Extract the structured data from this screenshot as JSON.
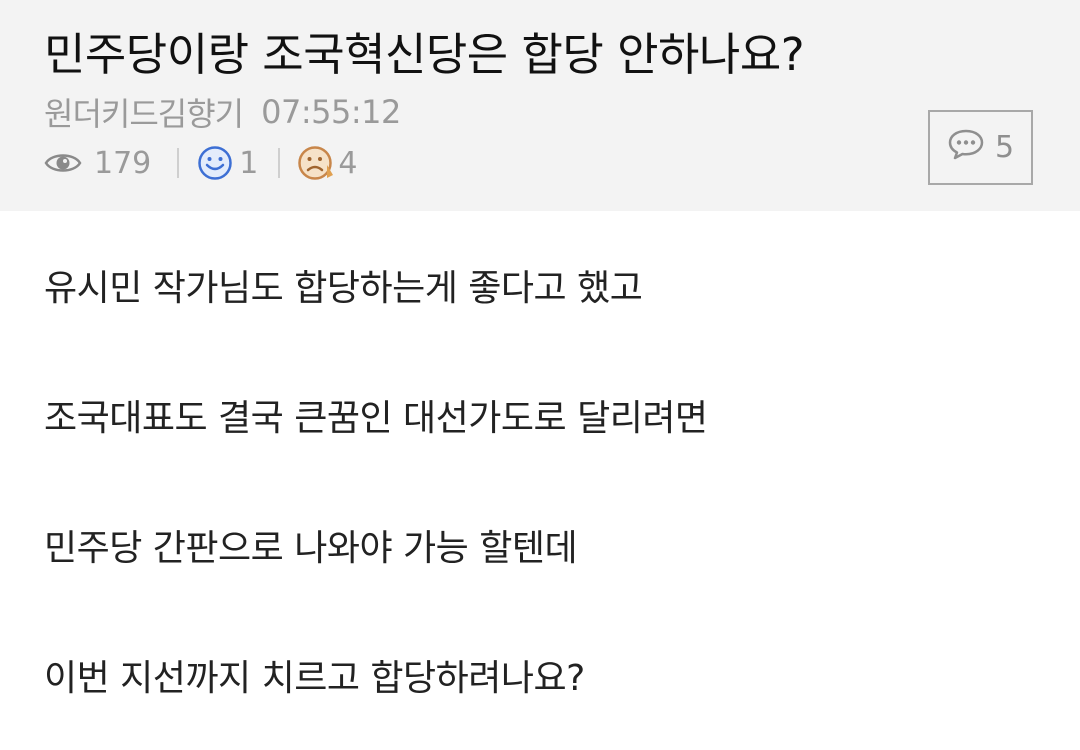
{
  "post": {
    "title": "민주당이랑 조국혁신당은 합당 안하나요?",
    "author": "원더키드김향기",
    "time": "07:55:12",
    "views": "179",
    "likes": "1",
    "dislikes": "4",
    "comments": "5"
  },
  "icons": {
    "views": "eye-icon",
    "likes": "smiley-icon",
    "dislikes": "sad-face-icon",
    "comments": "speech-bubble-icon"
  },
  "content": {
    "lines": [
      "유시민 작가님도 합당하는게 좋다고 했고",
      "조국대표도 결국 큰꿈인 대선가도로 달리려면",
      "민주당 간판으로 나와야 가능 할텐데",
      "이번 지선까지 치르고 합당하려나요?"
    ]
  }
}
